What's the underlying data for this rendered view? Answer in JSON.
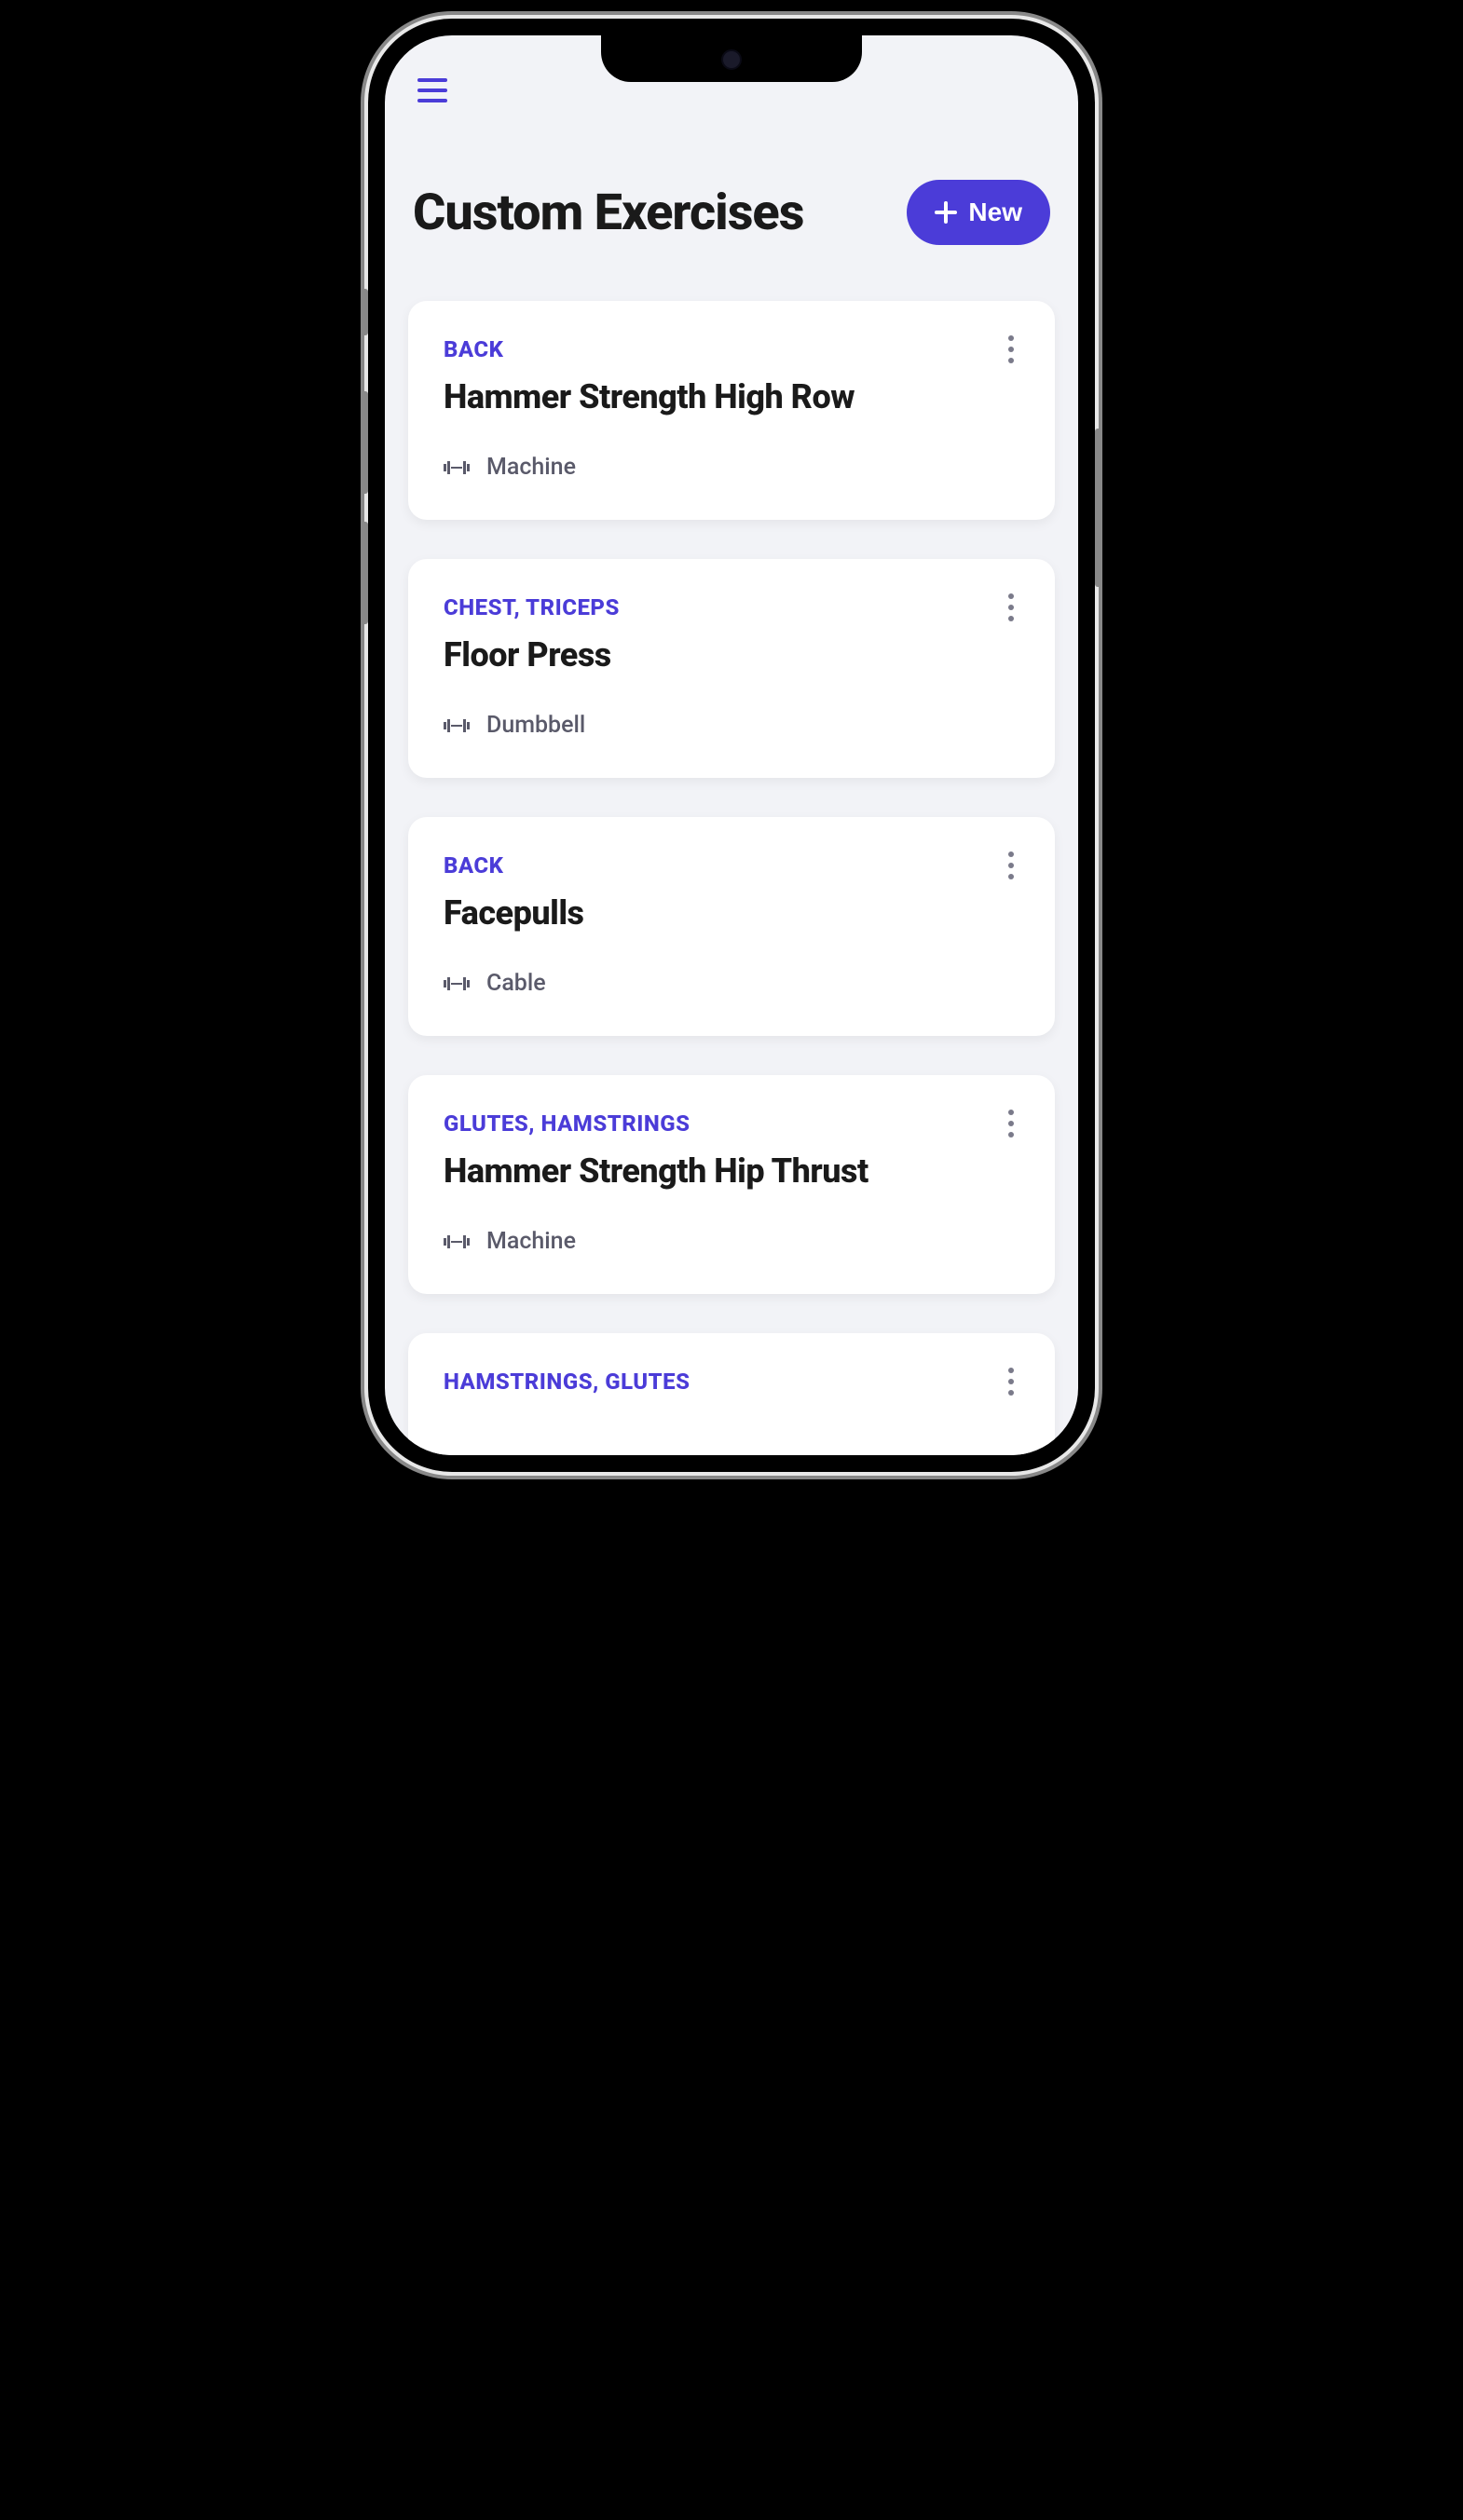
{
  "header": {
    "title": "Custom Exercises",
    "newButton": "New"
  },
  "exercises": [
    {
      "muscleGroups": "BACK",
      "name": "Hammer Strength High Row",
      "equipment": "Machine"
    },
    {
      "muscleGroups": "CHEST, TRICEPS",
      "name": "Floor Press",
      "equipment": "Dumbbell"
    },
    {
      "muscleGroups": "BACK",
      "name": "Facepulls",
      "equipment": "Cable"
    },
    {
      "muscleGroups": "GLUTES, HAMSTRINGS",
      "name": "Hammer Strength Hip Thrust",
      "equipment": "Machine"
    },
    {
      "muscleGroups": "HAMSTRINGS, GLUTES",
      "name": "",
      "equipment": ""
    }
  ]
}
